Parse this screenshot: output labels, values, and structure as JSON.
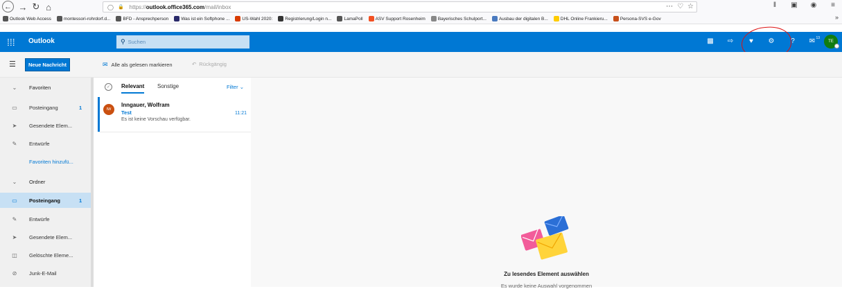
{
  "browser": {
    "url_prefix": "https://",
    "url_host": "outlook.office365.com",
    "url_path": "/mail/inbox",
    "bookmarks": [
      {
        "label": "Outlook Web Access",
        "color": "#555555"
      },
      {
        "label": "montessori-rohrdorf.d...",
        "color": "#555555"
      },
      {
        "label": "BFD - Ansprechperson",
        "color": "#555555"
      },
      {
        "label": "Was ist ein Softphone ...",
        "color": "#2a2a6a"
      },
      {
        "label": "US-Wahl 2020:",
        "color": "#d83b01"
      },
      {
        "label": "Registrierung/Login n...",
        "color": "#333333"
      },
      {
        "label": "LamaPoll",
        "color": "#555555"
      },
      {
        "label": "ASV Support Rosenheim",
        "color": "#f25022"
      },
      {
        "label": "Bayerisches Schulport...",
        "color": "#888888"
      },
      {
        "label": "Ausbau der digitalen B...",
        "color": "#4a7abf"
      },
      {
        "label": "DHL Online Frankieru...",
        "color": "#ffcc00"
      },
      {
        "label": "Persona-SVS e-Gov",
        "color": "#c8501a"
      }
    ],
    "bookmarks_more": "»"
  },
  "header": {
    "brand": "Outlook",
    "search_placeholder": "Suchen",
    "notification_count": "13",
    "avatar_initials": "TE",
    "accent": "#0078d4"
  },
  "command_bar": {
    "new_message": "Neue Nachricht",
    "mark_all_read": "Alle als gelesen markieren",
    "undo": "Rückgängig"
  },
  "sidebar": {
    "favorites_heading": "Favoriten",
    "favorites": [
      {
        "label": "Posteingang",
        "count": "1",
        "icon": "inbox-icon"
      },
      {
        "label": "Gesendete Elem...",
        "count": "",
        "icon": "send-icon"
      },
      {
        "label": "Entwürfe",
        "count": "",
        "icon": "pencil-icon"
      }
    ],
    "add_favorite": "Favoriten hinzufü...",
    "folders_heading": "Ordner",
    "folders": [
      {
        "label": "Posteingang",
        "count": "1",
        "icon": "inbox-icon",
        "selected": true
      },
      {
        "label": "Entwürfe",
        "count": "",
        "icon": "pencil-icon"
      },
      {
        "label": "Gesendete Elem...",
        "count": "",
        "icon": "send-icon"
      },
      {
        "label": "Gelöschte Eleme...",
        "count": "",
        "icon": "trash-icon"
      },
      {
        "label": "Junk-E-Mail",
        "count": "",
        "icon": "block-icon"
      }
    ]
  },
  "message_list": {
    "tab_focused": "Relevant",
    "tab_other": "Sonstige",
    "filter": "Filter",
    "messages": [
      {
        "initials": "IW",
        "sender": "Inngauer, Wolfram",
        "subject": "Test",
        "time": "11:21",
        "preview": "Es ist keine Vorschau verfügbar."
      }
    ]
  },
  "reading_pane": {
    "title": "Zu lesendes Element auswählen",
    "subtitle": "Es wurde keine Auswahl vorgenommen"
  }
}
